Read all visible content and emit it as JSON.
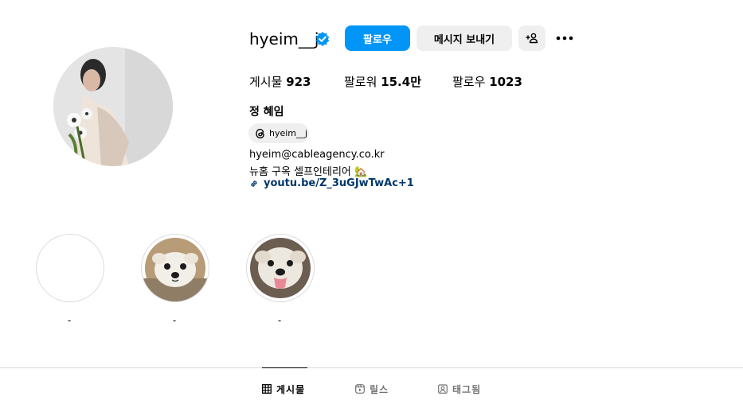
{
  "profile": {
    "username": "hyeim__j",
    "verified": true,
    "avatar_alt": "profile photo"
  },
  "actions": {
    "follow_label": "팔로우",
    "message_label": "메시지 보내기"
  },
  "stats": [
    {
      "label": "게시물",
      "value": "923"
    },
    {
      "label": "팔로워",
      "value": "15.4만"
    },
    {
      "label": "팔로우",
      "value": "1023"
    }
  ],
  "bio": {
    "full_name": "정 혜임",
    "threads_handle": "hyeim__j",
    "email_line": "hyeim@cableagency.co.kr",
    "description": "뉴홈 구옥 셀프인테리어 🏡",
    "link": "youtu.be/Z_3uGJwTwAc+1"
  },
  "highlights": [
    {
      "label": "-"
    },
    {
      "label": "-"
    },
    {
      "label": "-"
    }
  ],
  "tabs": [
    {
      "label": "게시물",
      "icon": "grid-icon",
      "active": true
    },
    {
      "label": "릴스",
      "icon": "reels-icon",
      "active": false
    },
    {
      "label": "태그됨",
      "icon": "tagged-icon",
      "active": false
    }
  ],
  "colors": {
    "accent": "#0095f6",
    "button_secondary": "#efefef",
    "link": "#00376b",
    "divider": "#dbdbdb"
  }
}
